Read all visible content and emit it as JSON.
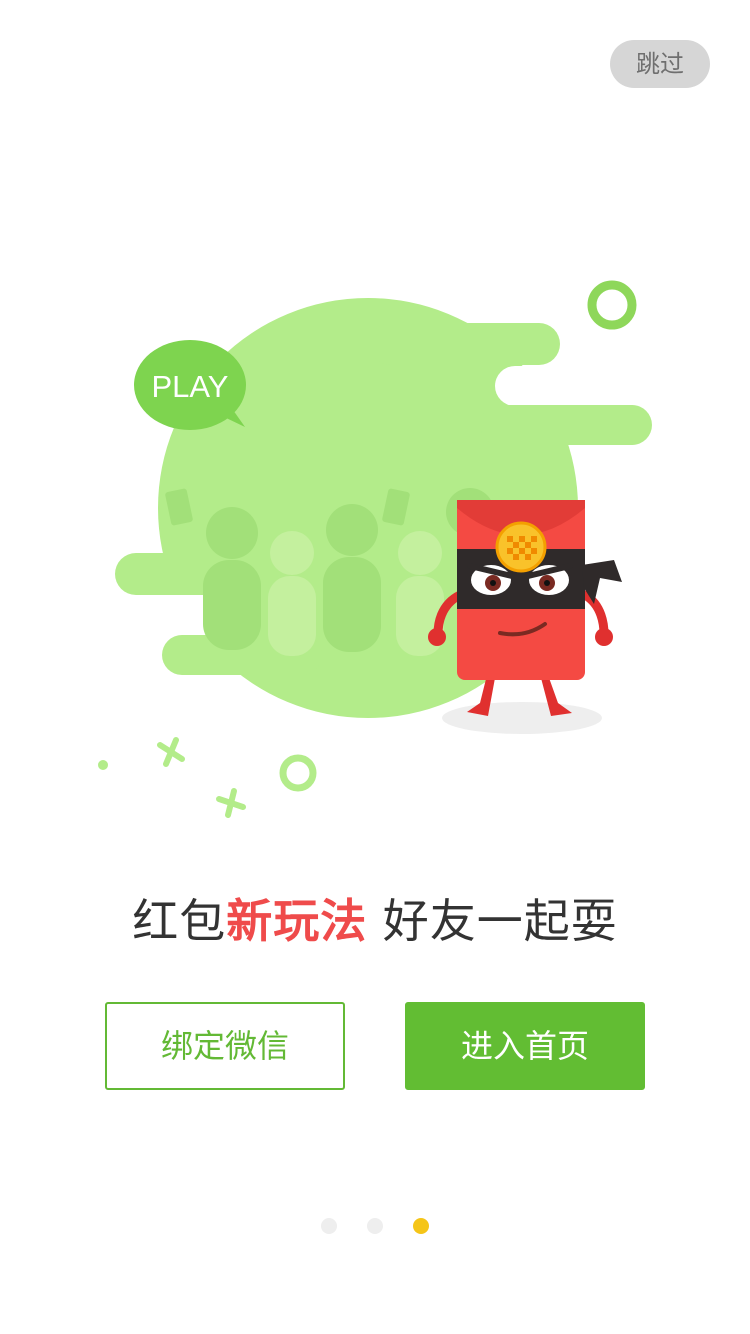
{
  "skip": {
    "label": "跳过"
  },
  "illustration": {
    "bubble_text": "PLAY"
  },
  "tagline": {
    "part1": "红包",
    "highlight": "新玩法",
    "part2": " 好友一起耍"
  },
  "buttons": {
    "bind_wechat": "绑定微信",
    "enter_home": "进入首页"
  },
  "pager": {
    "total": 3,
    "current": 3
  },
  "colors": {
    "accent_green": "#62bd33",
    "highlight_red": "#ef4b4b",
    "active_dot": "#f5c518"
  }
}
